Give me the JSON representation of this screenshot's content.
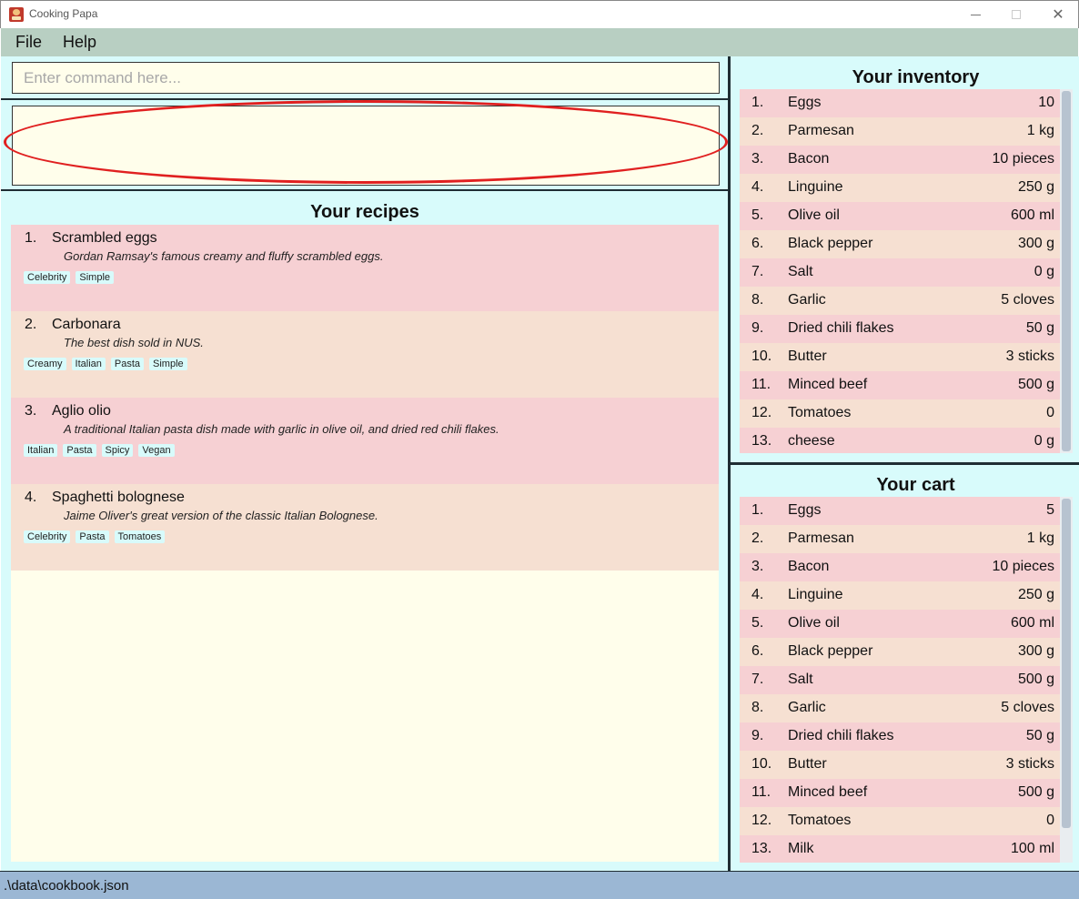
{
  "window": {
    "title": "Cooking Papa",
    "minimize_glyph": "",
    "maximize_glyph": "",
    "close_glyph": "✕"
  },
  "menu": {
    "file": "File",
    "help": "Help"
  },
  "command": {
    "placeholder": "Enter command here...",
    "value": ""
  },
  "result": {
    "text": ""
  },
  "recipes": {
    "title": "Your recipes",
    "items": [
      {
        "num": "1.",
        "name": "Scrambled eggs",
        "desc": "Gordan Ramsay's famous creamy and fluffy scrambled eggs.",
        "tags": [
          "Celebrity",
          "Simple"
        ]
      },
      {
        "num": "2.",
        "name": "Carbonara",
        "desc": "The best dish sold in NUS.",
        "tags": [
          "Creamy",
          "Italian",
          "Pasta",
          "Simple"
        ]
      },
      {
        "num": "3.",
        "name": "Aglio olio",
        "desc": "A traditional Italian pasta dish made with garlic in olive oil, and dried red chili flakes.",
        "tags": [
          "Italian",
          "Pasta",
          "Spicy",
          "Vegan"
        ]
      },
      {
        "num": "4.",
        "name": "Spaghetti bolognese",
        "desc": "Jaime Oliver's great version of the classic Italian Bolognese.",
        "tags": [
          "Celebrity",
          "Pasta",
          "Tomatoes"
        ]
      }
    ]
  },
  "inventory": {
    "title": "Your inventory",
    "items": [
      {
        "num": "1.",
        "name": "Eggs",
        "qty": "10"
      },
      {
        "num": "2.",
        "name": "Parmesan",
        "qty": "1 kg"
      },
      {
        "num": "3.",
        "name": "Bacon",
        "qty": "10 pieces"
      },
      {
        "num": "4.",
        "name": "Linguine",
        "qty": "250 g"
      },
      {
        "num": "5.",
        "name": "Olive oil",
        "qty": "600 ml"
      },
      {
        "num": "6.",
        "name": "Black pepper",
        "qty": "300 g"
      },
      {
        "num": "7.",
        "name": "Salt",
        "qty": "0 g"
      },
      {
        "num": "8.",
        "name": "Garlic",
        "qty": "5 cloves"
      },
      {
        "num": "9.",
        "name": "Dried chili flakes",
        "qty": "50 g"
      },
      {
        "num": "10.",
        "name": "Butter",
        "qty": "3 sticks"
      },
      {
        "num": "11.",
        "name": "Minced beef",
        "qty": "500 g"
      },
      {
        "num": "12.",
        "name": "Tomatoes",
        "qty": "0"
      },
      {
        "num": "13.",
        "name": "cheese",
        "qty": "0 g"
      }
    ]
  },
  "cart": {
    "title": "Your cart",
    "items": [
      {
        "num": "1.",
        "name": "Eggs",
        "qty": "5"
      },
      {
        "num": "2.",
        "name": "Parmesan",
        "qty": "1 kg"
      },
      {
        "num": "3.",
        "name": "Bacon",
        "qty": "10 pieces"
      },
      {
        "num": "4.",
        "name": "Linguine",
        "qty": "250 g"
      },
      {
        "num": "5.",
        "name": "Olive oil",
        "qty": "600 ml"
      },
      {
        "num": "6.",
        "name": "Black pepper",
        "qty": "300 g"
      },
      {
        "num": "7.",
        "name": "Salt",
        "qty": "500 g"
      },
      {
        "num": "8.",
        "name": "Garlic",
        "qty": "5 cloves"
      },
      {
        "num": "9.",
        "name": "Dried chili flakes",
        "qty": "50 g"
      },
      {
        "num": "10.",
        "name": "Butter",
        "qty": "3 sticks"
      },
      {
        "num": "11.",
        "name": "Minced beef",
        "qty": "500 g"
      },
      {
        "num": "12.",
        "name": "Tomatoes",
        "qty": "0"
      },
      {
        "num": "13.",
        "name": "Milk",
        "qty": "100 ml"
      }
    ]
  },
  "status": {
    "path": ".\\data\\cookbook.json"
  },
  "colors": {
    "menubar": "#b8cfc2",
    "panel": "#d8fbfb",
    "field": "#fffeeb",
    "row_odd": "#f6d0d3",
    "row_even": "#f6e0d2",
    "statusbar": "#9bb7d4",
    "annotation": "#e02020"
  }
}
